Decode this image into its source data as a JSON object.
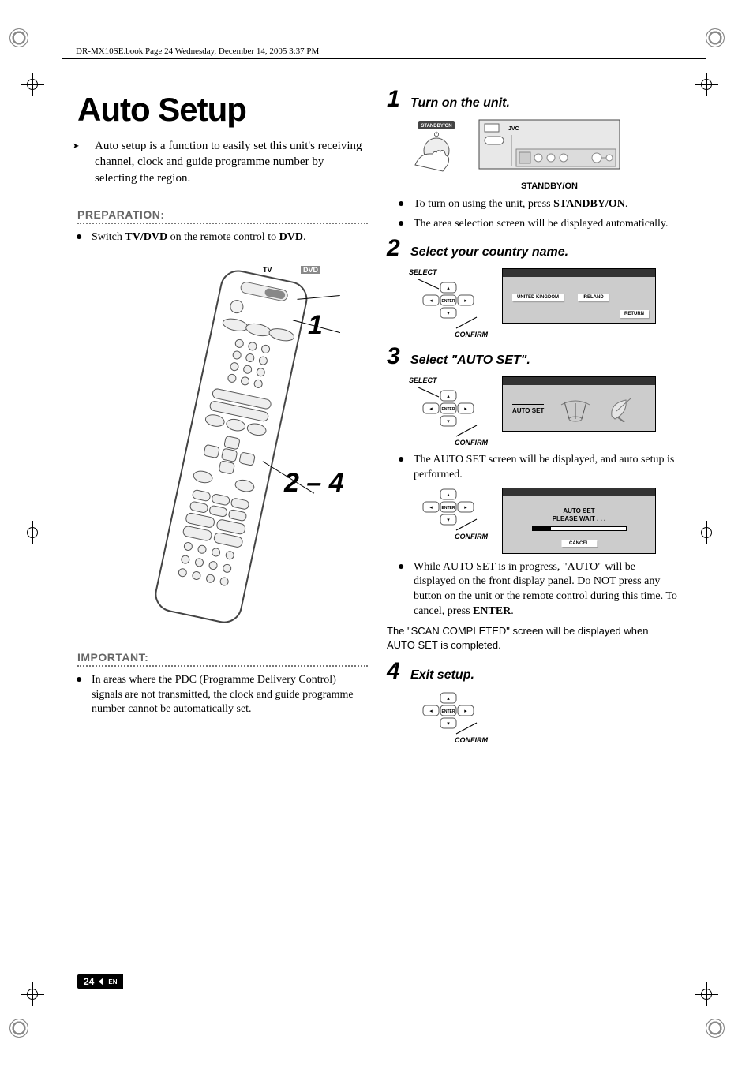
{
  "page_header": "DR-MX10SE.book  Page 24  Wednesday, December 14, 2005  3:37 PM",
  "title": "Auto Setup",
  "intro": "Auto setup is a function to easily set this unit's receiving channel, clock and guide programme number by selecting the region.",
  "preparation_label": "PREPARATION:",
  "preparation_item": {
    "pre": "Switch ",
    "bold1": "TV/DVD",
    "mid": " on the remote control to ",
    "bold2": "DVD",
    "post": "."
  },
  "remote_labels": {
    "tv": "TV",
    "dvd": "DVD",
    "one": "1",
    "range": "2 – 4"
  },
  "important_label": "IMPORTANT:",
  "important_item": "In areas where the PDC (Programme Delivery Control) signals are not transmitted, the clock and guide programme number cannot be automatically set.",
  "step1": {
    "num": "1",
    "title": "Turn on the unit.",
    "standby_btn": "STANDBY/ON",
    "caption": "STANDBY/ON",
    "brand": "JVC",
    "bullets": [
      {
        "pre": "To turn on using the unit, press ",
        "bold": "STANDBY/ON",
        "post": "."
      },
      {
        "text": "The area selection screen will be displayed automatically."
      }
    ]
  },
  "step2": {
    "num": "2",
    "title": "Select your country name.",
    "select": "SELECT",
    "enter": "ENTER",
    "confirm": "CONFIRM",
    "options": [
      "UNITED KINGDOM",
      "IRELAND"
    ],
    "return": "RETURN"
  },
  "step3": {
    "num": "3",
    "title": "Select \"AUTO SET\".",
    "select": "SELECT",
    "enter": "ENTER",
    "confirm": "CONFIRM",
    "screen1_label": "AUTO SET",
    "bullet1": "The AUTO SET screen will be displayed, and auto setup is performed.",
    "screen2_line1": "AUTO SET",
    "screen2_line2": "PLEASE WAIT . . .",
    "cancel": "CANCEL",
    "bullet2": {
      "pre": "While AUTO SET is in progress, \"AUTO\" will be displayed on the front display panel. Do NOT press any button on the unit or the remote control during this time. To cancel, press ",
      "bold": "ENTER",
      "post": "."
    },
    "completed": "The \"SCAN COMPLETED\" screen will be displayed when AUTO SET is completed."
  },
  "step4": {
    "num": "4",
    "title": "Exit setup.",
    "enter": "ENTER",
    "confirm": "CONFIRM"
  },
  "footer": {
    "page": "24",
    "lang": "EN"
  }
}
